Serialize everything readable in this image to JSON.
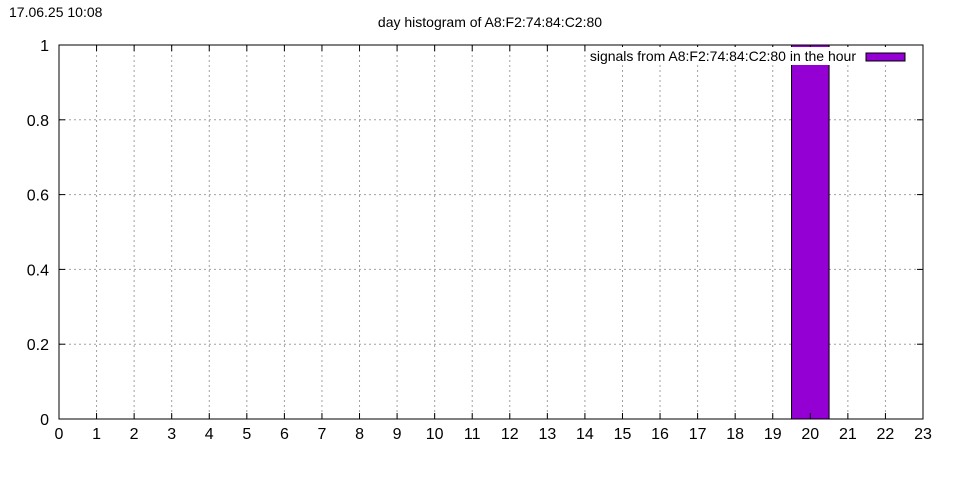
{
  "timestamp": "17.06.25 10:08",
  "chart_data": {
    "type": "bar",
    "title": "day histogram of A8:F2:74:84:C2:80",
    "xlabel": "",
    "ylabel": "",
    "xlim": [
      0,
      23
    ],
    "ylim": [
      0,
      1
    ],
    "x_ticks": [
      0,
      1,
      2,
      3,
      4,
      5,
      6,
      7,
      8,
      9,
      10,
      11,
      12,
      13,
      14,
      15,
      16,
      17,
      18,
      19,
      20,
      21,
      22,
      23
    ],
    "y_ticks": [
      "0",
      "0.2",
      "0.4",
      "0.6",
      "0.8",
      "1"
    ],
    "grid": true,
    "legend_position": "top-right",
    "series": [
      {
        "name": "signals from A8:F2:74:84:C2:80 in the hour",
        "color": "#9400d3",
        "x": [
          20
        ],
        "values": [
          1
        ]
      }
    ]
  }
}
